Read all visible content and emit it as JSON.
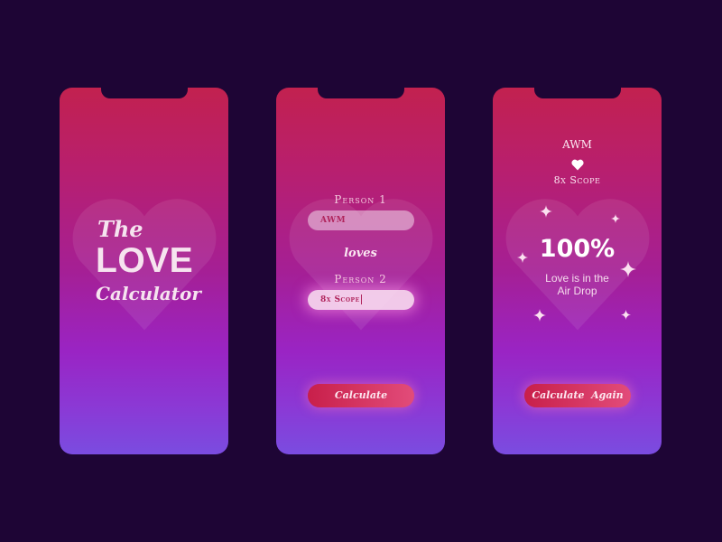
{
  "screen1": {
    "title_line1": "The",
    "title_line2": "LOVE",
    "title_line3": "Calculator"
  },
  "screen2": {
    "person1_label": "Person 1",
    "person1_value": "AWM",
    "connector": "loves",
    "person2_label": "Person 2",
    "person2_value": "8x Scope",
    "calculate_label": "Calculate"
  },
  "screen3": {
    "name1": "AWM",
    "heart_icon": "heart-icon",
    "name2": "8x Scope",
    "percentage": "100%",
    "message_line1": "Love is in the",
    "message_line2": "Air Drop",
    "calculate_again_label": "Calculate  Again"
  },
  "colors": {
    "background": "#1e0535",
    "gradient_top": "#c2214f",
    "gradient_bottom": "#7a4ce0",
    "button_start": "#c81f4a",
    "button_end": "#e24c7a"
  }
}
